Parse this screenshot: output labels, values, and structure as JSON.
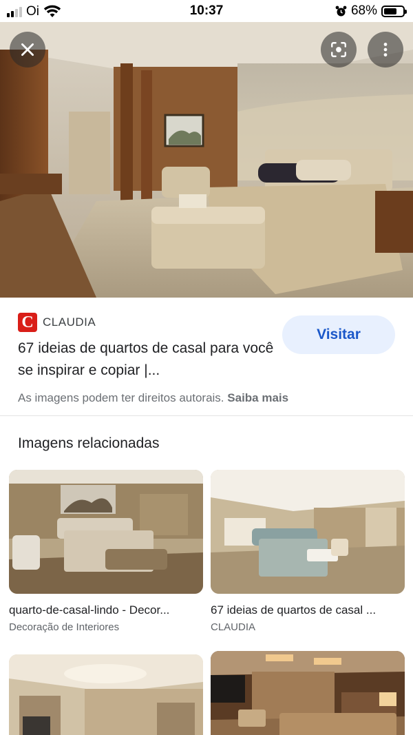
{
  "status_bar": {
    "carrier": "Oi",
    "time": "10:37",
    "battery_percent": "68%",
    "battery_level": 0.68
  },
  "hero": {
    "close_icon": "close-icon",
    "lens_icon": "lens-icon",
    "more_icon": "more-vert-icon"
  },
  "source": {
    "site_logo_letter": "C",
    "site_name": "CLAUDIA",
    "title": "67 ideias de quartos de casal para você se inspirar e copiar |...",
    "visit_label": "Visitar",
    "copyright_text": "As imagens podem ter direitos autorais.",
    "learn_more": "Saiba mais",
    "colors": {
      "logo": "#d91e18",
      "visit_bg": "#e8f0fe",
      "visit_text": "#1a57c9"
    }
  },
  "related": {
    "heading": "Imagens relacionadas",
    "items": [
      {
        "title": "quarto-de-casal-lindo - Decor...",
        "source": "Decoração de Interiores"
      },
      {
        "title": "67 ideias de quartos de casal ...",
        "source": "CLAUDIA"
      },
      {
        "title": "",
        "source": ""
      },
      {
        "title": "",
        "source": ""
      }
    ]
  }
}
